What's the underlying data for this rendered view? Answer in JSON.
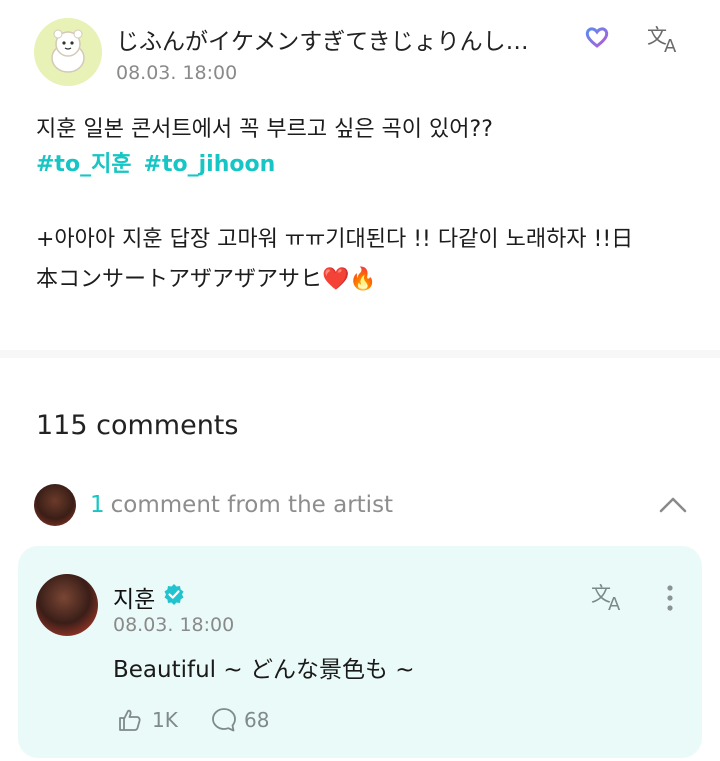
{
  "post": {
    "username": "じふんがイケメンすぎてきじょりんし…",
    "timestamp": "08.03. 18:00",
    "line1": "지훈 일본 콘서트에서 꼭 부르고 싶은 곡이 있어??",
    "hashtags": [
      "#to_지훈",
      "#to_jihoon"
    ],
    "line2": "+아아아 지훈 답장 고마워 ㅠㅠ기대된다 !! 다같이 노래하자 !!日",
    "line3": "本コンサートアザアザアサヒ❤️🔥"
  },
  "comments": {
    "count_label": "115 comments",
    "artist_count": "1",
    "artist_label": "comment from the artist"
  },
  "artist_comment": {
    "name": "지훈",
    "timestamp": "08.03. 18:00",
    "text": "Beautiful ~ どんな景色も ~",
    "likes": "1K",
    "replies": "68"
  },
  "colors": {
    "accent": "#17c6c4",
    "card_bg": "#eafaf8",
    "muted": "#8a8a8a"
  },
  "icons": [
    "translate-icon",
    "membership-heart-icon",
    "verified-icon",
    "chevron-up-icon",
    "more-vertical-icon",
    "like-icon",
    "reply-icon"
  ]
}
